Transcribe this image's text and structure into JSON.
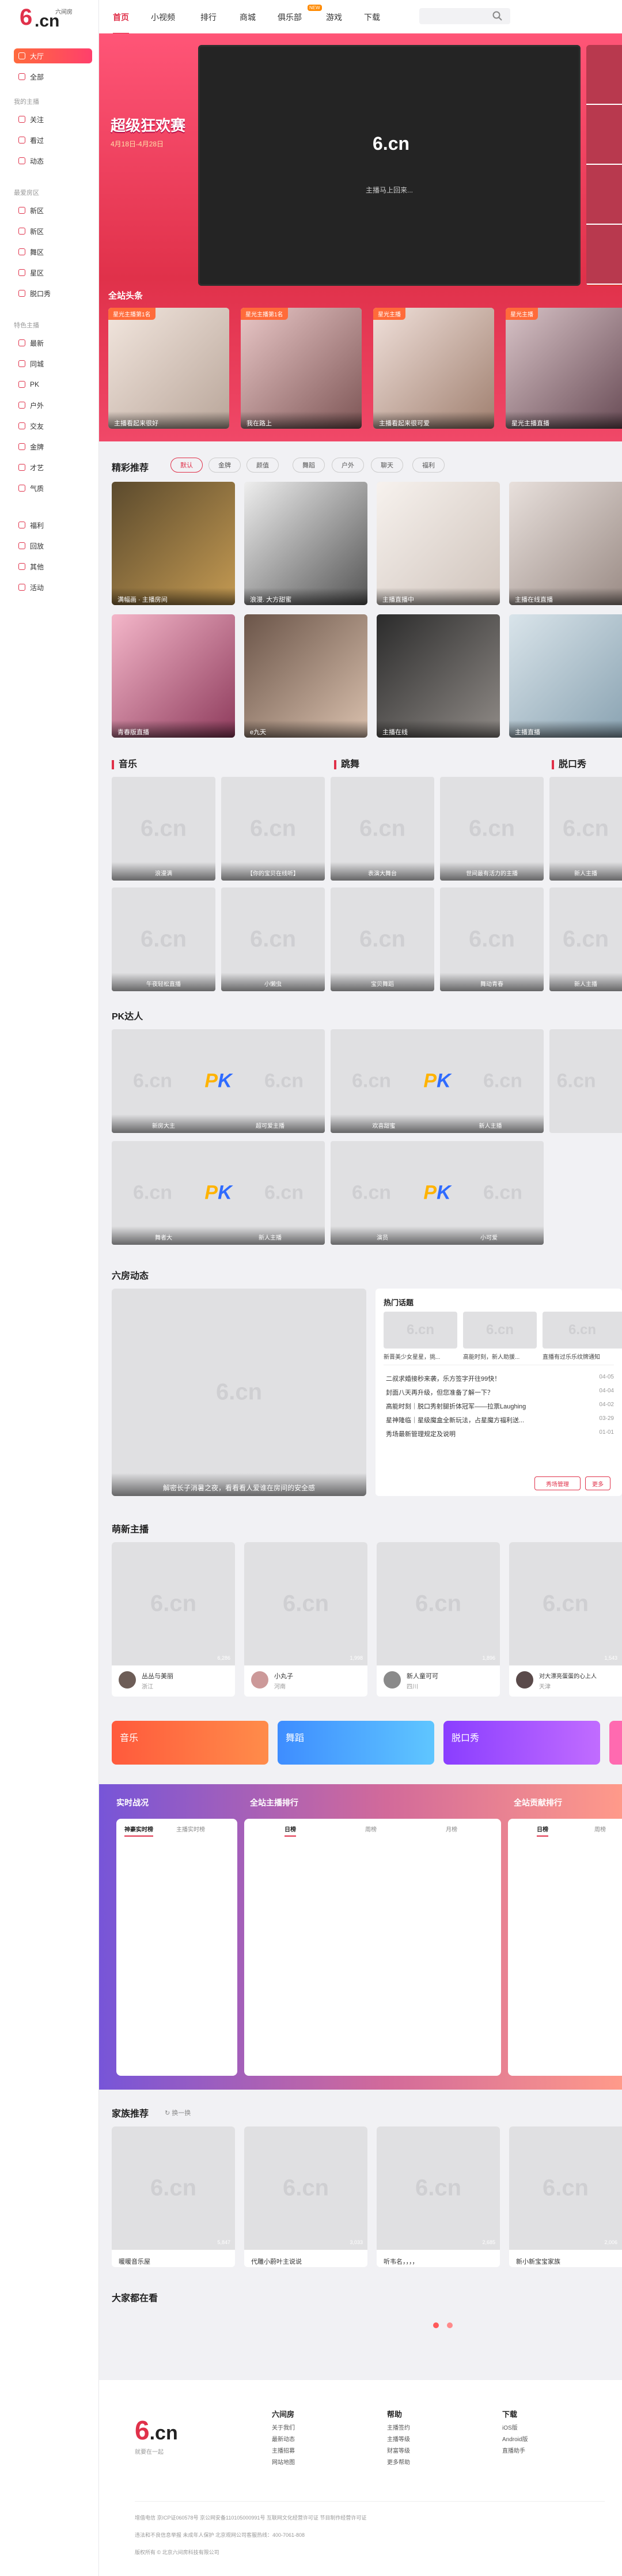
{
  "brand": {
    "site": "6.cn",
    "name": "六间房",
    "slogan": "就要在一起",
    "accent": "#e0314a"
  },
  "sidebar": {
    "primary": [
      {
        "label": "大厅",
        "icon": "home-icon"
      },
      {
        "label": "全部",
        "icon": "grid-icon"
      }
    ],
    "my_group": "我的主播",
    "my_items": [
      {
        "label": "关注",
        "icon": "heart-icon"
      },
      {
        "label": "看过",
        "icon": "clock-icon"
      },
      {
        "label": "动态",
        "icon": "activity-icon"
      }
    ],
    "elite_group": "最爱房区",
    "elite_items": [
      {
        "label": "新区",
        "icon": "star-icon"
      },
      {
        "label": "新区",
        "icon": "star-icon"
      },
      {
        "label": "舞区",
        "icon": "dance-icon"
      },
      {
        "label": "星区",
        "icon": "star-icon"
      },
      {
        "label": "脱口秀",
        "icon": "mic-icon"
      }
    ],
    "feature_group": "特色主播",
    "feature_items": [
      {
        "label": "最新",
        "icon": "new-icon"
      },
      {
        "label": "同城",
        "icon": "location-icon"
      },
      {
        "label": "PK",
        "icon": "pk-icon"
      },
      {
        "label": "户外",
        "icon": "outdoor-icon"
      },
      {
        "label": "交友",
        "icon": "friends-icon"
      },
      {
        "label": "金牌",
        "icon": "medal-icon"
      },
      {
        "label": "才艺",
        "icon": "talent-icon"
      },
      {
        "label": "气质",
        "icon": "crown-icon"
      }
    ],
    "other_items": [
      {
        "label": "福利",
        "icon": "gift-icon"
      },
      {
        "label": "回放",
        "icon": "replay-icon"
      },
      {
        "label": "其他",
        "icon": "more-icon"
      },
      {
        "label": "活动",
        "icon": "event-icon"
      }
    ]
  },
  "nav": {
    "links": [
      "首页",
      "小视频",
      "排行",
      "商城",
      "俱乐部",
      "游戏",
      "下载"
    ],
    "hot_badge": "NEW"
  },
  "hero": {
    "promo_title": "超级狂欢赛",
    "promo_date": "4月18日-4月28日",
    "player_logo": "6.cn",
    "player_msg": "主播马上回来...",
    "headline_title": "全站头条",
    "headline_cards": [
      {
        "tag": "星光主播第1名",
        "caption": "主播看起来很好"
      },
      {
        "tag": "星光主播第1名",
        "caption": "我在路上"
      },
      {
        "tag": "星光主播",
        "caption": "主播看起来很可爱"
      },
      {
        "tag": "星光主播",
        "caption": "星光主播直播"
      }
    ]
  },
  "featured": {
    "title": "精彩推荐",
    "tabs": [
      "默认",
      "金牌",
      "颜值",
      "舞蹈",
      "户外",
      "聊天",
      "福利"
    ],
    "cards": [
      "满幅画 · 主播房间",
      "浪漫. 大方甜蜜",
      "主播直播中",
      "主播在线直播",
      "青春版直播",
      "e九天",
      "主播在线",
      "主播直播"
    ]
  },
  "music": {
    "title": "音乐",
    "captions": [
      "浪漫满",
      "【你的宝贝在线听】",
      "午夜轻松直播",
      "小懒虫"
    ]
  },
  "dance": {
    "title": "跳舞",
    "captions": [
      "表演大舞台",
      "世间最有活力的主播",
      "宝贝舞蹈",
      "舞动青春"
    ]
  },
  "talk": {
    "title": "脱口秀",
    "captions": [
      "新人主播",
      "新人主播"
    ]
  },
  "pk": {
    "title": "PK达人",
    "captions": [
      [
        "新房大主",
        "超可爱主播"
      ],
      [
        "欢喜甜蜜",
        "新人主播"
      ],
      [
        "舞者大",
        "新人主播"
      ],
      [
        "演员",
        "小可爱"
      ]
    ]
  },
  "dynamic": {
    "title": "六房动态",
    "banner_caption": "解密长子消暑之夜，看看看人爱谁在房间的安全感",
    "topic_title": "热门话题",
    "topics": [
      "新晋美少女星星，挑...",
      "高能时刻，新人助援...",
      "直播有过乐乐纹牌通知"
    ],
    "news": [
      {
        "text": "二叔求婚接秒来袭，乐方签字开往99快！",
        "date": "04-05"
      },
      {
        "text": "封面八天再升级，但您准备了解一下？",
        "date": "04-04"
      },
      {
        "text": "高能时刻｜脱口秀射腿折体冠军——拉票Laughing",
        "date": "04-02"
      },
      {
        "text": "星神隆临｜星级魔盒全新玩法，占星魔方福利送...",
        "date": "03-29"
      },
      {
        "text": "秀场最新管理规定及说明",
        "date": "01-01"
      }
    ],
    "btn_rule": "秀场管理",
    "btn_more": "更多"
  },
  "new_anchors": {
    "title": "萌新主播",
    "cards": [
      {
        "name": "丛丛与美丽",
        "city": "浙江",
        "count": "6,286"
      },
      {
        "name": "小丸子",
        "city": "河南",
        "count": "1,998"
      },
      {
        "name": "新人童可可",
        "city": "四川",
        "count": "1,896"
      },
      {
        "name": "对大漂亮蛋蛋的心上人",
        "city": "天津",
        "count": "1,543"
      }
    ]
  },
  "categories": [
    {
      "label": "音乐",
      "color": "#ff6a3d"
    },
    {
      "label": "舞蹈",
      "color": "#3ea8ff"
    },
    {
      "label": "脱口秀",
      "color": "#a94dff"
    }
  ],
  "ranks": {
    "live": {
      "title": "实时战况",
      "tabs": [
        "神豪实时榜",
        "主播实时榜"
      ]
    },
    "anchor": {
      "title": "全站主播排行",
      "tabs": [
        "日榜",
        "周榜",
        "月榜"
      ]
    },
    "rich": {
      "title": "全站贡献排行",
      "tabs": [
        "日榜",
        "周榜"
      ]
    }
  },
  "family": {
    "title": "家族推荐",
    "refresh": "换一换",
    "cards": [
      {
        "name": "暖暖音乐屋",
        "count": "5,847"
      },
      {
        "name": "代雕小蔚叶主说说",
        "count": "3,033"
      },
      {
        "name": "听韦名，，，，",
        "count": "2,685"
      },
      {
        "name": "新小新宝宝家族",
        "count": "2,006"
      }
    ]
  },
  "watching": {
    "title": "大家都在看"
  },
  "footer": {
    "cols": [
      {
        "title": "六间房",
        "links": [
          "关于我们",
          "最新动态",
          "主播招募",
          "网站地图"
        ]
      },
      {
        "title": "帮助",
        "links": [
          "主播签约",
          "主播等级",
          "财富等级",
          "更多帮助"
        ]
      },
      {
        "title": "下载",
        "links": [
          "iOS版",
          "Android版",
          "直播助手"
        ]
      }
    ],
    "lines": [
      "增值电信   京ICP证060578号   京公网安备110105000991号   互联网文化经营许可证   节目制作经营许可证",
      "违法和不良信息举报   未成年人保护   北京观网公司客服热线：400-7061-808",
      "版权所有 © 北京六间房科技有限公司"
    ]
  }
}
